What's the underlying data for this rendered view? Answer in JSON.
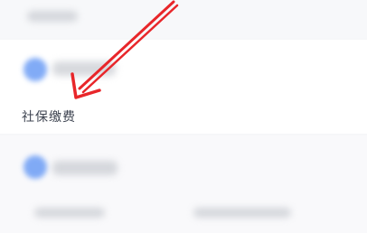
{
  "feature_item": {
    "label": "社保缴费",
    "icon": "social-security-icon"
  },
  "blurred_items": [
    {
      "icon": "service-icon"
    },
    {
      "icon": "service-icon"
    }
  ],
  "annotation": {
    "type": "arrow",
    "color": "#e8262a"
  },
  "colors": {
    "background": "#f6f7f9",
    "accent_icon": "#6c9df5",
    "label_text": "#3d4350"
  }
}
